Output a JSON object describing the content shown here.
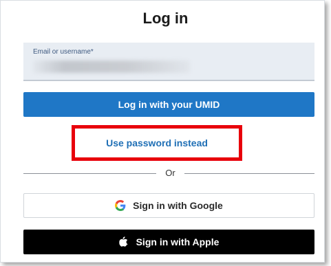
{
  "title": "Log in",
  "email_field": {
    "label": "Email or username*",
    "value": ""
  },
  "umid_button": "Log in with your UMID",
  "password_link": "Use password instead",
  "divider_text": "Or",
  "google_button": "Sign in with Google",
  "apple_button": "Sign in with Apple",
  "icons": {
    "google": "google-icon",
    "apple": "apple-icon"
  },
  "colors": {
    "primary": "#1f77c6",
    "link": "#1f6fb5",
    "highlight": "#e8000b",
    "apple_bg": "#000000"
  }
}
